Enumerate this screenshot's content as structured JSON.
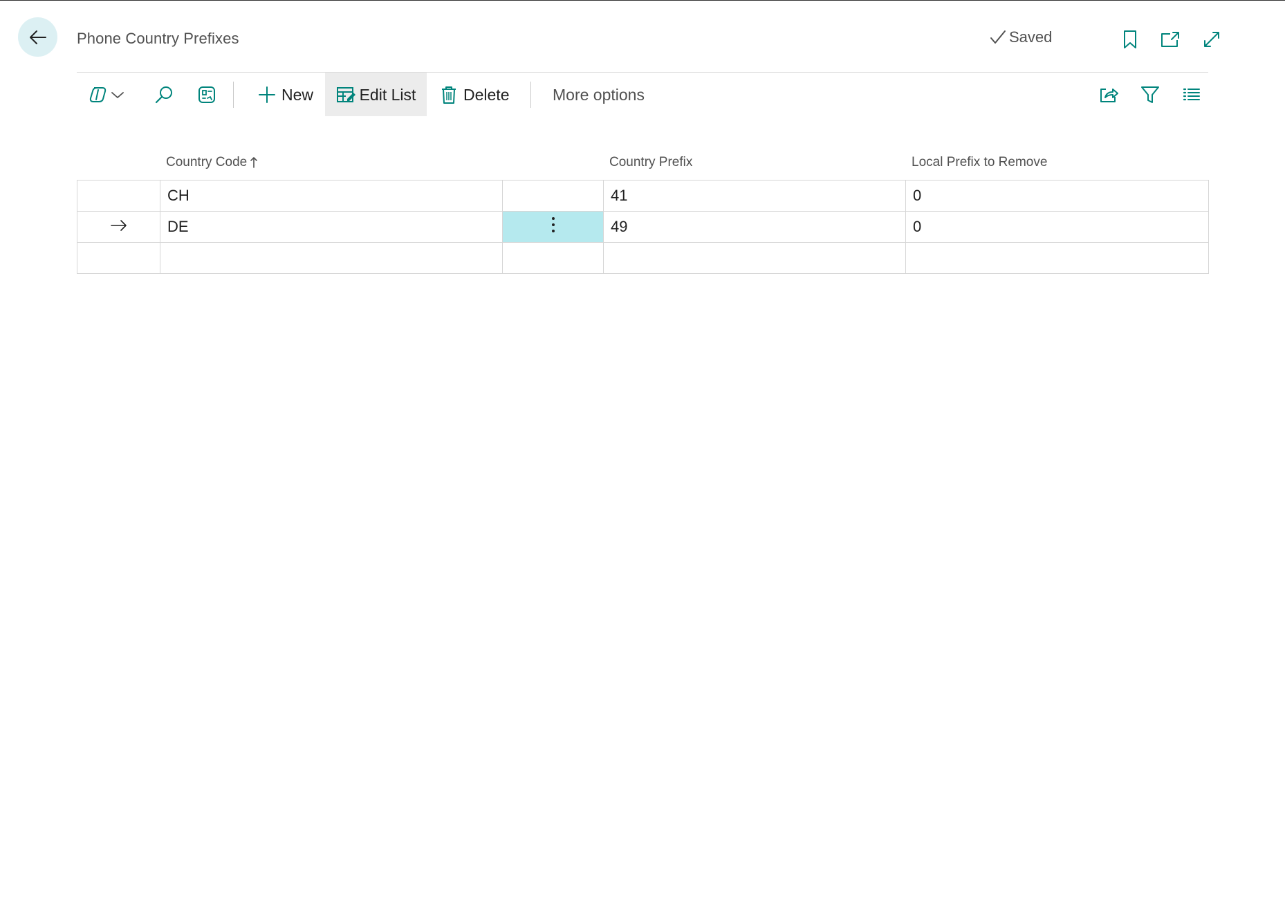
{
  "page": {
    "title": "Phone Country Prefixes",
    "status": "Saved"
  },
  "header_icons": [
    "bookmark-icon",
    "open-new-window-icon",
    "expand-icon"
  ],
  "toolbar": {
    "copilot_icon": "copilot-icon",
    "search_icon": "search-icon",
    "analysis_icon": "analysis-icon",
    "new_label": "New",
    "edit_list_label": "Edit List",
    "delete_label": "Delete",
    "more_options_label": "More options",
    "right_icons": [
      "share-icon",
      "filter-icon",
      "list-view-icon"
    ]
  },
  "grid": {
    "columns": {
      "country_code": "Country Code",
      "country_prefix": "Country Prefix",
      "local_prefix": "Local Prefix to Remove"
    },
    "sort_column": "country_code",
    "sort_direction": "ascending",
    "rows": [
      {
        "country_code": "CH",
        "country_prefix": "41",
        "local_prefix": "0",
        "selected": false
      },
      {
        "country_code": "DE",
        "country_prefix": "49",
        "local_prefix": "0",
        "selected": true
      },
      {
        "country_code": "",
        "country_prefix": "",
        "local_prefix": "",
        "selected": false
      }
    ]
  },
  "colors": {
    "accent": "#00847c",
    "selected_cell": "#b5e9ee",
    "back_button_bg": "#dcf0f3",
    "active_toolbar_bg": "#ececec"
  }
}
